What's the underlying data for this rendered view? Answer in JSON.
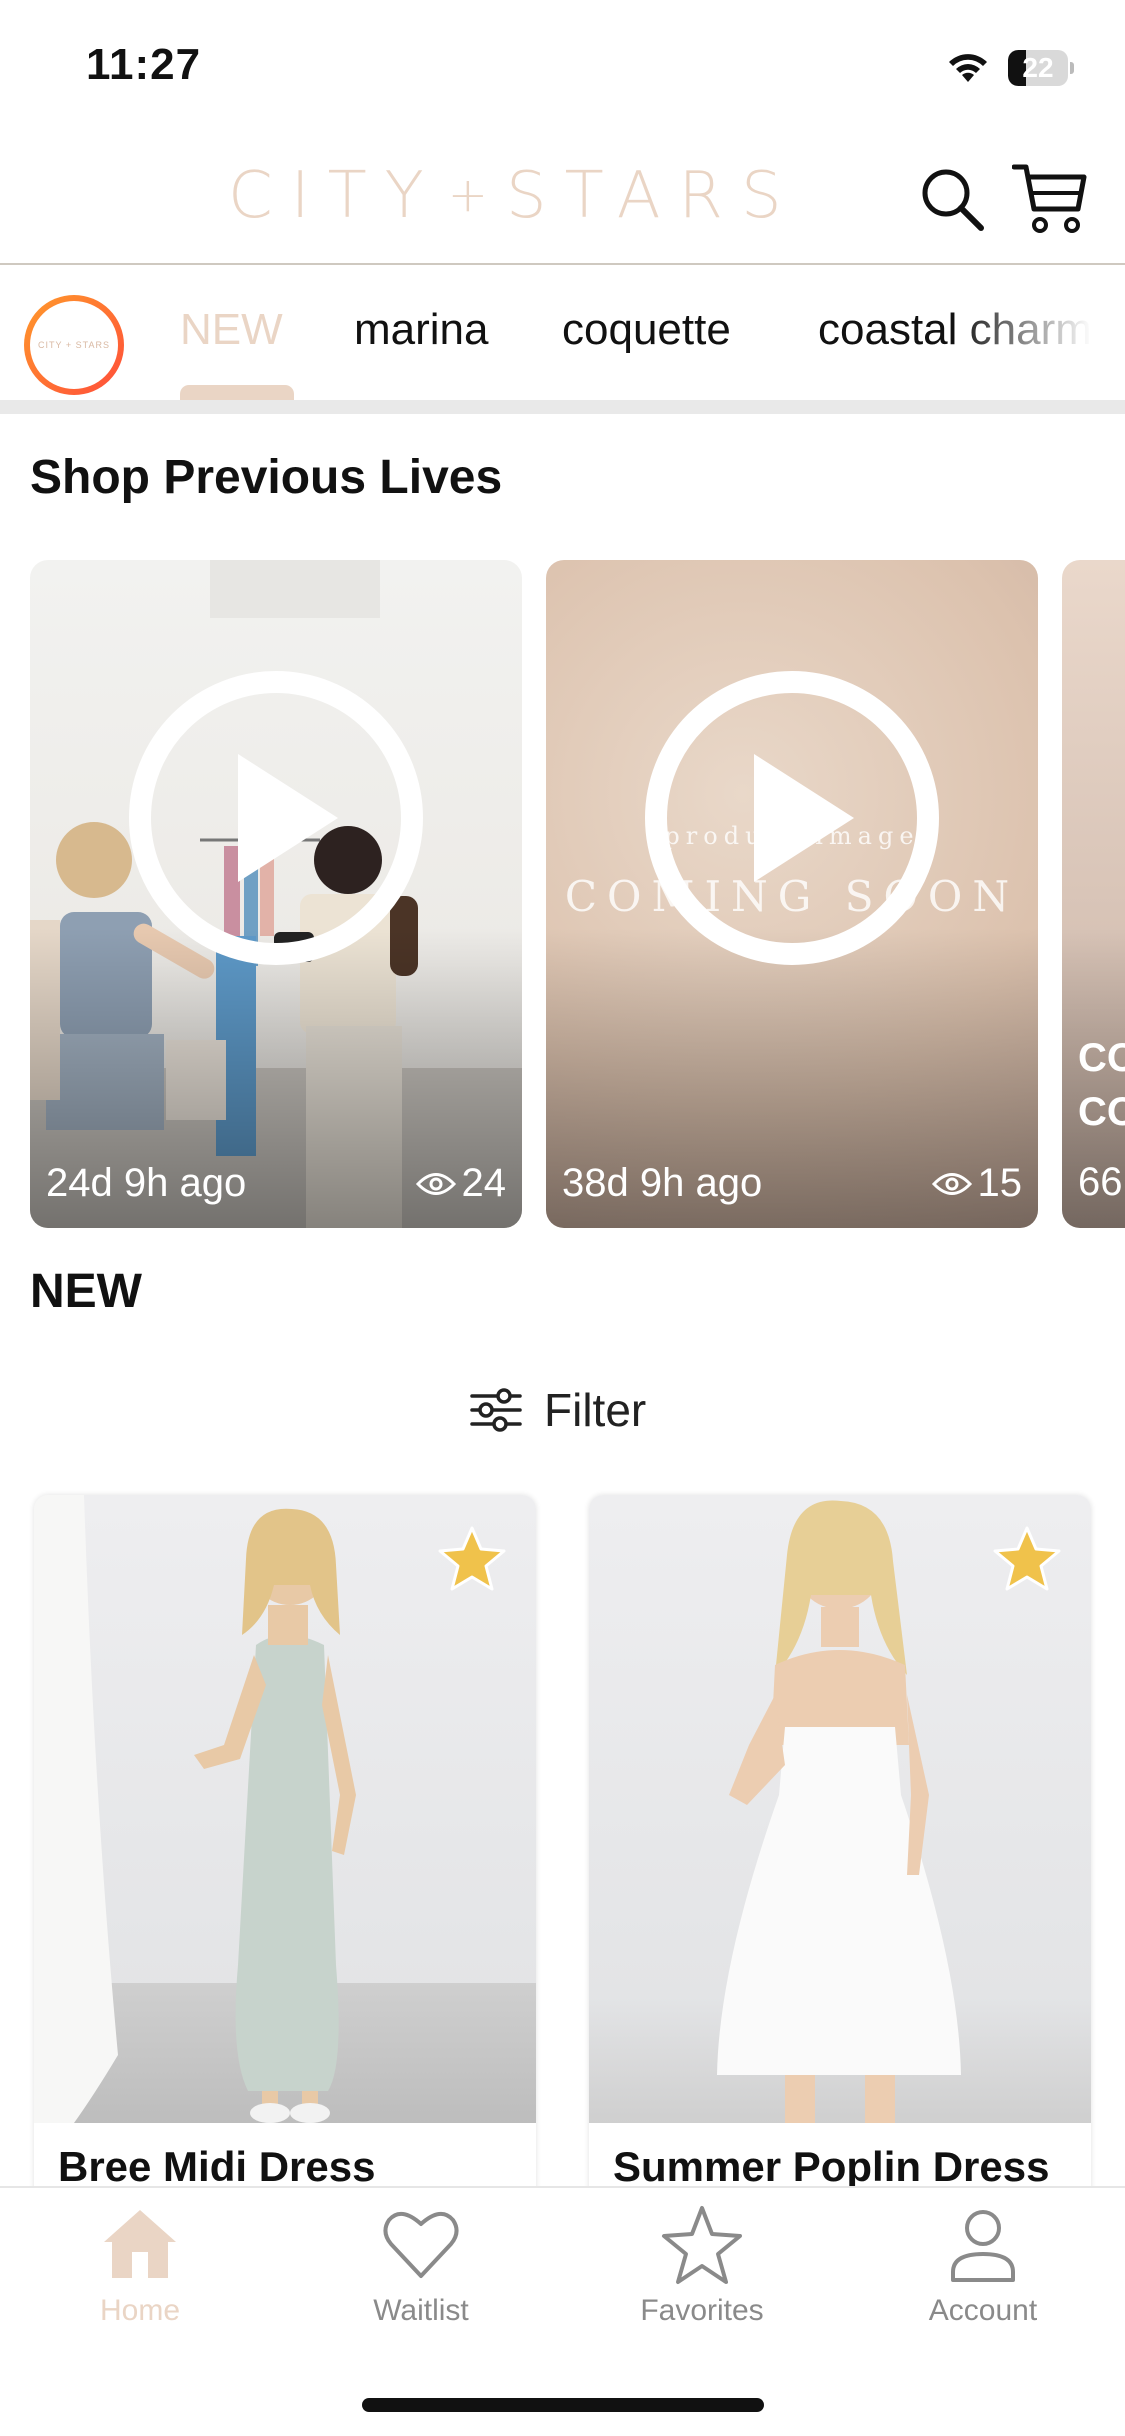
{
  "status_bar": {
    "time": "11:27",
    "battery_level": "22"
  },
  "header": {
    "logo_left": "CITY",
    "logo_plus": "+",
    "logo_right": "STARS",
    "logo_avatar_text": "CITY + STARS"
  },
  "categories": {
    "items": [
      {
        "label": "NEW",
        "active": true
      },
      {
        "label": "marina",
        "active": false
      },
      {
        "label": "coquette",
        "active": false
      },
      {
        "label": "coastal charm",
        "active": false
      }
    ]
  },
  "lives": {
    "title": "Shop Previous Lives",
    "cards": [
      {
        "age": "24d 9h ago",
        "views": "24"
      },
      {
        "age": "38d 9h ago",
        "views": "15",
        "overlay_top": "product image",
        "overlay_main": "COMING SOON"
      },
      {
        "line1": "CO",
        "line2": "CO",
        "age": "66"
      }
    ]
  },
  "new_section": {
    "title": "NEW",
    "filter_label": "Filter"
  },
  "products": [
    {
      "name": "Bree Midi Dress",
      "favorite": true,
      "dress_color": "#c7d3cc"
    },
    {
      "name": "Summer Poplin Dress",
      "favorite": true,
      "dress_color": "#fafafa"
    }
  ],
  "colors": {
    "brand_accent": "#ead5c5",
    "star": "#f0c24b"
  },
  "tabbar": {
    "items": [
      {
        "label": "Home",
        "icon": "home-icon",
        "active": true
      },
      {
        "label": "Waitlist",
        "icon": "heart-icon",
        "active": false
      },
      {
        "label": "Favorites",
        "icon": "star-icon",
        "active": false
      },
      {
        "label": "Account",
        "icon": "person-icon",
        "active": false
      }
    ]
  }
}
